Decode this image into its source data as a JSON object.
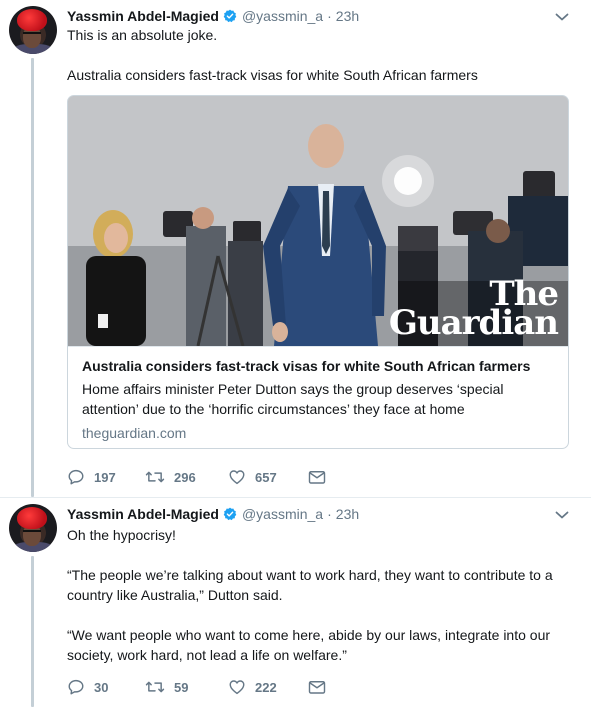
{
  "colors": {
    "verified_blue": "#1da1f2",
    "secondary_text": "#657786",
    "thread_line": "#c4cfd6"
  },
  "tweets": [
    {
      "author_name": "Yassmin Abdel-Magied",
      "handle": "@yassmin_a",
      "separator": "·",
      "time": "23h",
      "text": "This is an absolute joke.\n\nAustralia considers fast-track visas for white South African farmers",
      "card": {
        "image_logo_line1": "The",
        "image_logo_line2": "Guardian",
        "title": "Australia considers fast-track visas for white South African farmers",
        "description": "Home affairs minister Peter Dutton says the group deserves ‘special attention’ due to the ‘horrific circumstances’ they face at home",
        "domain": "theguardian.com"
      },
      "actions": {
        "replies": "197",
        "retweets": "296",
        "likes": "657"
      },
      "icons": [
        "reply-icon",
        "retweet-icon",
        "like-icon",
        "direct-message-icon",
        "chevron-down-icon",
        "verified-badge-icon"
      ]
    },
    {
      "author_name": "Yassmin Abdel-Magied",
      "handle": "@yassmin_a",
      "separator": "·",
      "time": "23h",
      "text": "Oh the hypocrisy!\n\n“The people we’re talking about want to work hard, they want to contribute to a country like Australia,” Dutton said.\n\n“We want people who want to come here, abide by our laws, integrate into our society, work hard, not lead a life on welfare.”",
      "actions": {
        "replies": "30",
        "retweets": "59",
        "likes": "222"
      },
      "icons": [
        "reply-icon",
        "retweet-icon",
        "like-icon",
        "direct-message-icon",
        "chevron-down-icon",
        "verified-badge-icon"
      ]
    }
  ]
}
